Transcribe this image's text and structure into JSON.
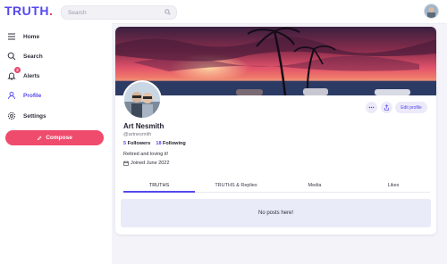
{
  "app": {
    "logo_text": "TRUTH",
    "logo_dot": ".",
    "brand_color": "#5448ee",
    "accent_color": "#ef4b6d"
  },
  "search": {
    "placeholder": "Search"
  },
  "sidebar": {
    "items": [
      {
        "label": "Home",
        "icon": "home-icon"
      },
      {
        "label": "Search",
        "icon": "search-icon"
      },
      {
        "label": "Alerts",
        "icon": "bell-icon",
        "badge": "2"
      },
      {
        "label": "Profile",
        "icon": "user-icon",
        "active": true
      },
      {
        "label": "Settings",
        "icon": "gear-icon"
      }
    ],
    "compose_label": "Compose"
  },
  "profile": {
    "name": "Art Nesmith",
    "handle": "@artnesmith",
    "followers_count": "5",
    "followers_label": "Followers",
    "following_count": "18",
    "following_label": "Following",
    "bio": "Retired and loving it!",
    "joined": "Joined June 2022",
    "edit_label": "Edit profile"
  },
  "tabs": [
    {
      "label": "TRUTHS",
      "active": true
    },
    {
      "label": "TRUTHS & Replies"
    },
    {
      "label": "Media"
    },
    {
      "label": "Likes"
    }
  ],
  "feed": {
    "empty_text": "No posts here!"
  }
}
